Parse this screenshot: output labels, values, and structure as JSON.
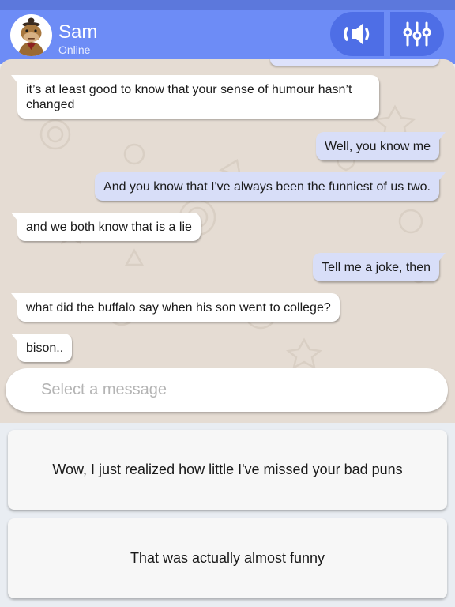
{
  "header": {
    "contact_name": "Sam",
    "contact_status": "Online",
    "sound_icon": "speaker-icon",
    "settings_icon": "sliders-icon"
  },
  "colors": {
    "header": "#6d8cf6",
    "header_button": "#4e6ee6",
    "chat_background": "#e5dcd3",
    "incoming_bubble": "#ffffff",
    "outgoing_bubble": "#d8def8"
  },
  "messages": [
    {
      "from": "contact",
      "text": "it’s at least good to know that your sense of humour hasn’t changed"
    },
    {
      "from": "me",
      "text": "Well, you know me"
    },
    {
      "from": "me",
      "text": "And you know that I've always been the funniest of us two."
    },
    {
      "from": "contact",
      "text": "and we both know that is a lie"
    },
    {
      "from": "me",
      "text": "Tell me a joke, then"
    },
    {
      "from": "contact",
      "text": "what did the buffalo say when his son went to college?"
    },
    {
      "from": "contact",
      "text": "bison.."
    }
  ],
  "composer": {
    "placeholder": "Select a message"
  },
  "options": [
    {
      "label": "Wow, I just realized how little I've missed your bad puns"
    },
    {
      "label": "That was actually almost funny"
    }
  ]
}
